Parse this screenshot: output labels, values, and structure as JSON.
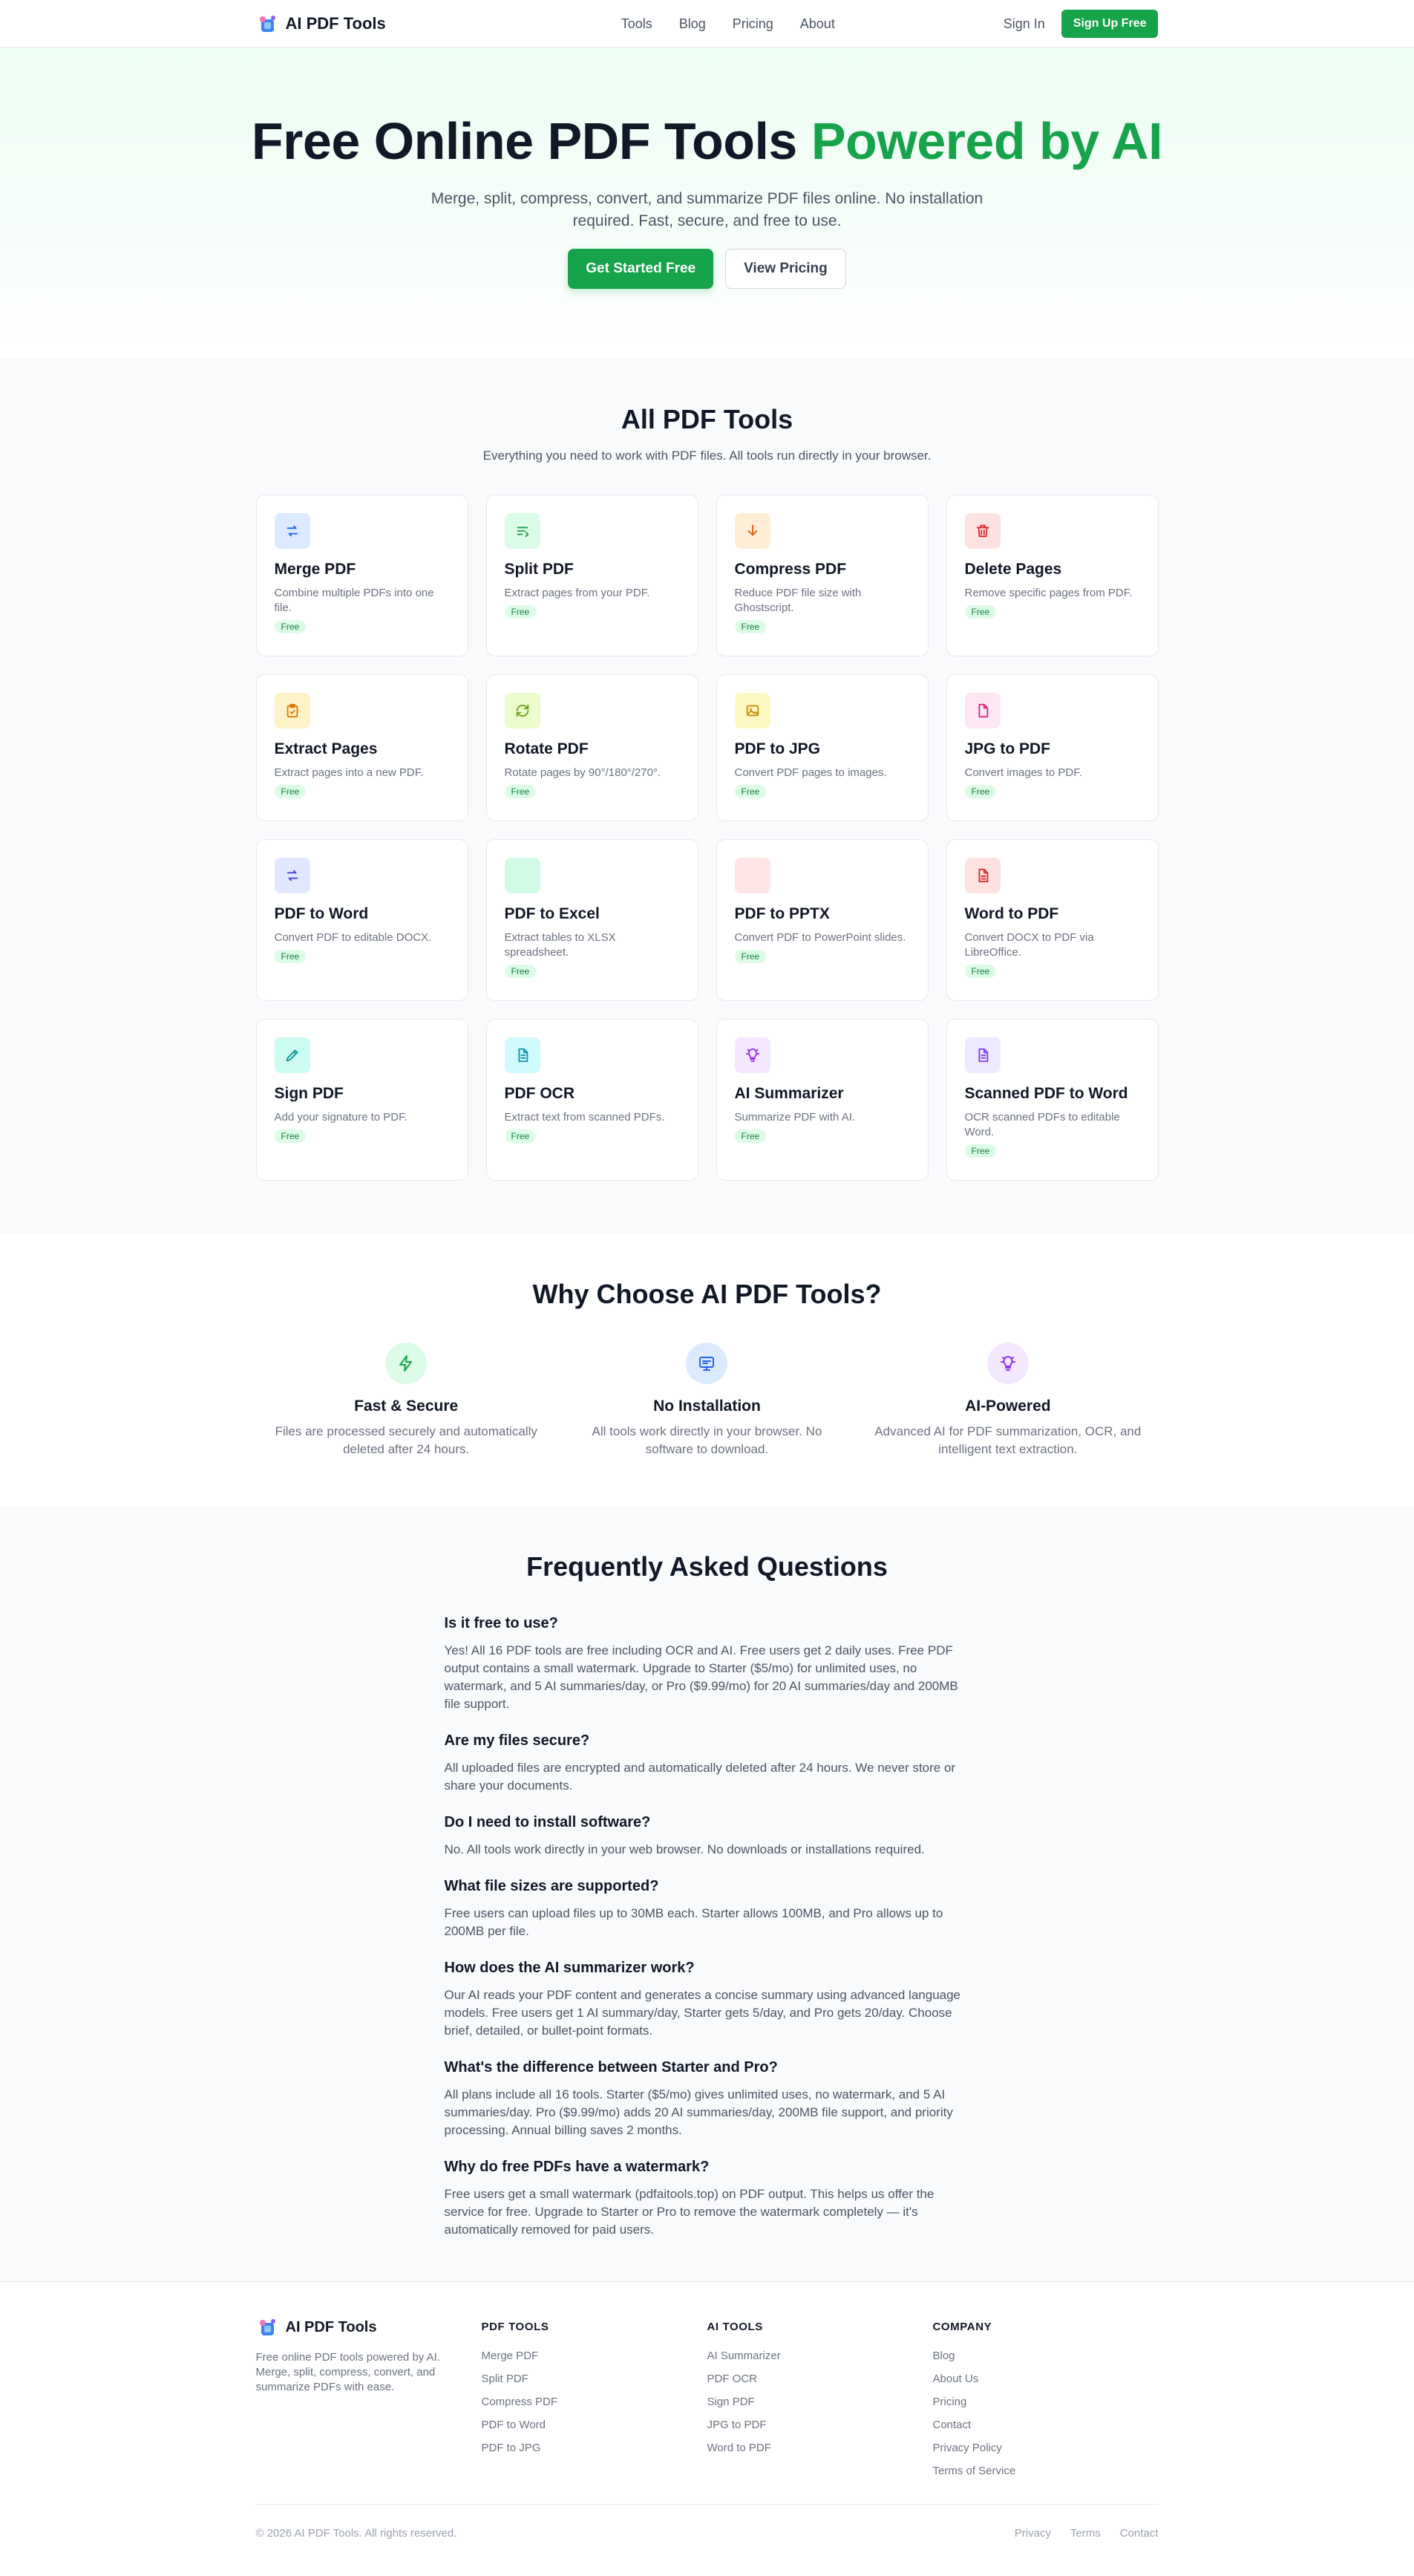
{
  "nav": {
    "brand": "AI PDF Tools",
    "links": [
      "Tools",
      "Blog",
      "Pricing",
      "About"
    ],
    "signin": "Sign In",
    "signup": "Sign Up Free"
  },
  "hero": {
    "title_main": "Free Online PDF Tools",
    "title_accent": "Powered by AI",
    "subtitle": "Merge, split, compress, convert, and summarize PDF files online. No installation required. Fast, secure, and free to use.",
    "primary_button": "Get Started Free",
    "secondary_button": "View Pricing"
  },
  "tools": {
    "title": "All PDF Tools",
    "subtitle": "Everything you need to work with PDF files. All tools run directly in your browser.",
    "badge": "Free",
    "items": [
      {
        "name": "Merge PDF",
        "desc": "Combine multiple PDFs into one file.",
        "icon": "merge-icon",
        "bg": "#dbeafe",
        "fg": "#2563eb"
      },
      {
        "name": "Split PDF",
        "desc": "Extract pages from your PDF.",
        "icon": "split-icon",
        "bg": "#dcfce7",
        "fg": "#16a34a"
      },
      {
        "name": "Compress PDF",
        "desc": "Reduce PDF file size with Ghostscript.",
        "icon": "compress-icon",
        "bg": "#ffedd5",
        "fg": "#ea580c"
      },
      {
        "name": "Delete Pages",
        "desc": "Remove specific pages from PDF.",
        "icon": "trash-icon",
        "bg": "#fee2e2",
        "fg": "#dc2626"
      },
      {
        "name": "Extract Pages",
        "desc": "Extract pages into a new PDF.",
        "icon": "clipboard-icon",
        "bg": "#fef3c7",
        "fg": "#d97706"
      },
      {
        "name": "Rotate PDF",
        "desc": "Rotate pages by 90°/180°/270°.",
        "icon": "rotate-icon",
        "bg": "#ecfccb",
        "fg": "#65a30d"
      },
      {
        "name": "PDF to JPG",
        "desc": "Convert PDF pages to images.",
        "icon": "image-icon",
        "bg": "#fef9c3",
        "fg": "#ca8a04"
      },
      {
        "name": "JPG to PDF",
        "desc": "Convert images to PDF.",
        "icon": "file-icon",
        "bg": "#fce7f3",
        "fg": "#db2777"
      },
      {
        "name": "PDF to Word",
        "desc": "Convert PDF to editable DOCX.",
        "icon": "convert-icon",
        "bg": "#e0e7ff",
        "fg": "#4f46e5"
      },
      {
        "name": "PDF to Excel",
        "desc": "Extract tables to XLSX spreadsheet.",
        "icon": "",
        "bg": "#d1fae5",
        "fg": "#059669"
      },
      {
        "name": "PDF to PPTX",
        "desc": "Convert PDF to PowerPoint slides.",
        "icon": "",
        "bg": "#ffe4e6",
        "fg": "#e11d48"
      },
      {
        "name": "Word to PDF",
        "desc": "Convert DOCX to PDF via LibreOffice.",
        "icon": "document-icon",
        "bg": "#fee2e2",
        "fg": "#dc2626"
      },
      {
        "name": "Sign PDF",
        "desc": "Add your signature to PDF.",
        "icon": "pen-icon",
        "bg": "#ccfbf1",
        "fg": "#0d9488"
      },
      {
        "name": "PDF OCR",
        "desc": "Extract text from scanned PDFs.",
        "icon": "scan-icon",
        "bg": "#cffafe",
        "fg": "#0891b2"
      },
      {
        "name": "AI Summarizer",
        "desc": "Summarize PDF with AI.",
        "icon": "bulb-icon",
        "bg": "#f3e8ff",
        "fg": "#9333ea"
      },
      {
        "name": "Scanned PDF to Word",
        "desc": "OCR scanned PDFs to editable Word.",
        "icon": "doc-text-icon",
        "bg": "#ede9fe",
        "fg": "#7c3aed"
      }
    ]
  },
  "why": {
    "title": "Why Choose AI PDF Tools?",
    "items": [
      {
        "title": "Fast & Secure",
        "desc": "Files are processed securely and automatically deleted after 24 hours.",
        "icon": "bolt-icon",
        "bg": "#dcfce7",
        "fg": "#16a34a"
      },
      {
        "title": "No Installation",
        "desc": "All tools work directly in your browser. No software to download.",
        "icon": "monitor-icon",
        "bg": "#dbeafe",
        "fg": "#2563eb"
      },
      {
        "title": "AI-Powered",
        "desc": "Advanced AI for PDF summarization, OCR, and intelligent text extraction.",
        "icon": "bulb-icon",
        "bg": "#f3e8ff",
        "fg": "#9333ea"
      }
    ]
  },
  "faq": {
    "title": "Frequently Asked Questions",
    "items": [
      {
        "q": "Is it free to use?",
        "a": "Yes! All 16 PDF tools are free including OCR and AI. Free users get 2 daily uses. Free PDF output contains a small watermark. Upgrade to Starter ($5/mo) for unlimited uses, no watermark, and 5 AI summaries/day, or Pro ($9.99/mo) for 20 AI summaries/day and 200MB file support."
      },
      {
        "q": "Are my files secure?",
        "a": "All uploaded files are encrypted and automatically deleted after 24 hours. We never store or share your documents."
      },
      {
        "q": "Do I need to install software?",
        "a": "No. All tools work directly in your web browser. No downloads or installations required."
      },
      {
        "q": "What file sizes are supported?",
        "a": "Free users can upload files up to 30MB each. Starter allows 100MB, and Pro allows up to 200MB per file."
      },
      {
        "q": "How does the AI summarizer work?",
        "a": "Our AI reads your PDF content and generates a concise summary using advanced language models. Free users get 1 AI summary/day, Starter gets 5/day, and Pro gets 20/day. Choose brief, detailed, or bullet-point formats."
      },
      {
        "q": "What's the difference between Starter and Pro?",
        "a": "All plans include all 16 tools. Starter ($5/mo) gives unlimited uses, no watermark, and 5 AI summaries/day. Pro ($9.99/mo) adds 20 AI summaries/day, 200MB file support, and priority processing. Annual billing saves 2 months."
      },
      {
        "q": "Why do free PDFs have a watermark?",
        "a": "Free users get a small watermark (pdfaitools.top) on PDF output. This helps us offer the service for free. Upgrade to Starter or Pro to remove the watermark completely — it's automatically removed for paid users."
      }
    ]
  },
  "footer": {
    "brand": "AI PDF Tools",
    "about": "Free online PDF tools powered by AI. Merge, split, compress, convert, and summarize PDFs with ease.",
    "columns": [
      {
        "title": "PDF TOOLS",
        "links": [
          "Merge PDF",
          "Split PDF",
          "Compress PDF",
          "PDF to Word",
          "PDF to JPG"
        ]
      },
      {
        "title": "AI TOOLS",
        "links": [
          "AI Summarizer",
          "PDF OCR",
          "Sign PDF",
          "JPG to PDF",
          "Word to PDF"
        ]
      },
      {
        "title": "COMPANY",
        "links": [
          "Blog",
          "About Us",
          "Pricing",
          "Contact",
          "Privacy Policy",
          "Terms of Service"
        ]
      }
    ],
    "copyright": "© 2026 AI PDF Tools. All rights reserved.",
    "bottom_links": [
      "Privacy",
      "Terms",
      "Contact"
    ]
  }
}
